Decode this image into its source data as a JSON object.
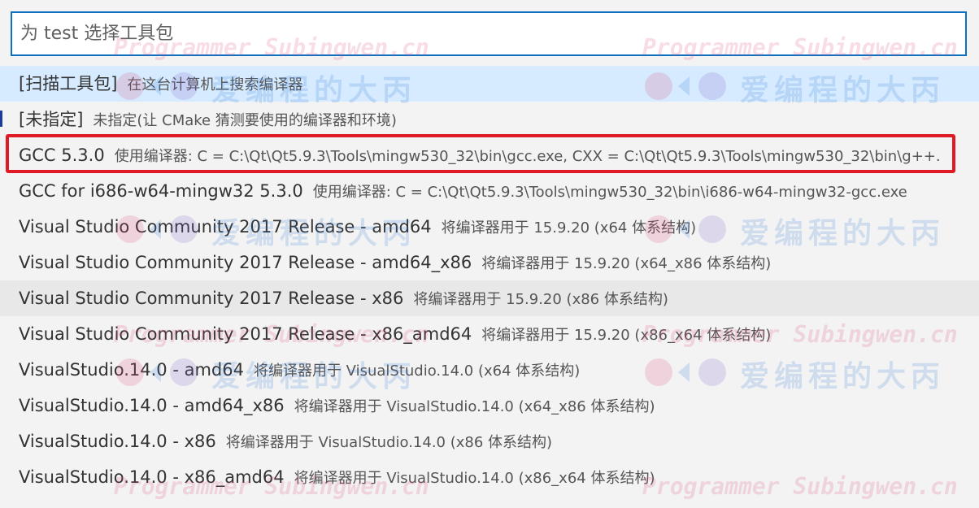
{
  "search": {
    "placeholder": "为 test 选择工具包",
    "value": ""
  },
  "items": [
    {
      "label": "[扫描工具包]",
      "desc": "在这台计算机上搜索编译器"
    },
    {
      "label": "[未指定]",
      "desc": "未指定(让 CMake 猜测要使用的编译器和环境)"
    },
    {
      "label": "GCC 5.3.0",
      "desc": "使用编译器: C = C:\\Qt\\Qt5.9.3\\Tools\\mingw530_32\\bin\\gcc.exe, CXX = C:\\Qt\\Qt5.9.3\\Tools\\mingw530_32\\bin\\g++.exe"
    },
    {
      "label": "GCC for i686-w64-mingw32 5.3.0",
      "desc": "使用编译器: C = C:\\Qt\\Qt5.9.3\\Tools\\mingw530_32\\bin\\i686-w64-mingw32-gcc.exe"
    },
    {
      "label": "Visual Studio Community 2017 Release - amd64",
      "desc": "将编译器用于 15.9.20 (x64 体系结构)"
    },
    {
      "label": "Visual Studio Community 2017 Release - amd64_x86",
      "desc": "将编译器用于 15.9.20 (x64_x86 体系结构)"
    },
    {
      "label": "Visual Studio Community 2017 Release - x86",
      "desc": "将编译器用于 15.9.20 (x86 体系结构)"
    },
    {
      "label": "Visual Studio Community 2017 Release - x86_amd64",
      "desc": "将编译器用于 15.9.20 (x86_x64 体系结构)"
    },
    {
      "label": "VisualStudio.14.0 - amd64",
      "desc": "将编译器用于 VisualStudio.14.0 (x64 体系结构)"
    },
    {
      "label": "VisualStudio.14.0 - amd64_x86",
      "desc": "将编译器用于 VisualStudio.14.0 (x64_x86 体系结构)"
    },
    {
      "label": "VisualStudio.14.0 - x86",
      "desc": "将编译器用于 VisualStudio.14.0 (x86 体系结构)"
    },
    {
      "label": "VisualStudio.14.0 - x86_amd64",
      "desc": "将编译器用于 VisualStudio.14.0 (x86_x64 体系结构)"
    }
  ],
  "watermark": {
    "text_en": "Programmer Subingwen.cn",
    "text_cn": "爱编程的大丙"
  },
  "colors": {
    "focus_border": "#0e70c0",
    "selected_bg": "#d6ebff",
    "hover_bg": "#e8e8e8",
    "annotation_red": "#e01a24"
  }
}
